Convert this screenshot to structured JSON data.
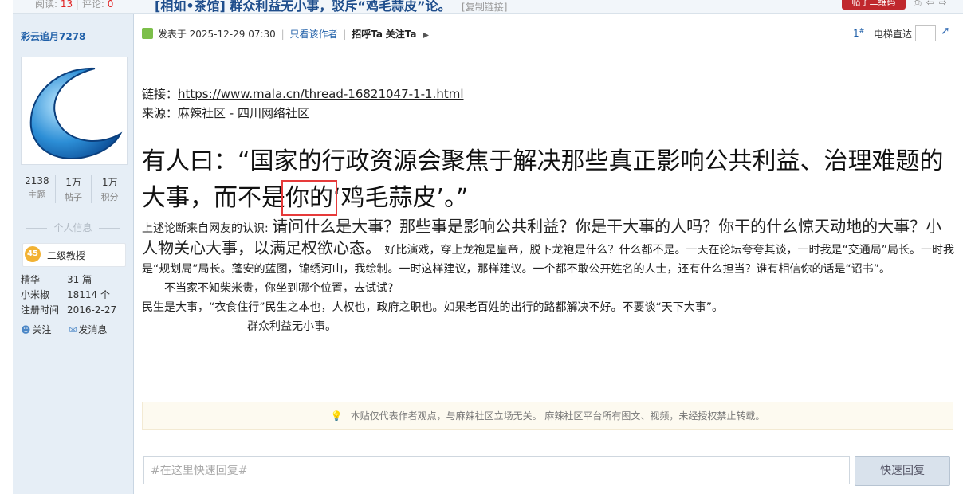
{
  "top": {
    "reads_label": "阅读:",
    "reads": "13",
    "comments_label": "评论:",
    "comments": "0",
    "title": "[相如•茶馆] 群众利益无小事，驳斥“鸡毛蒜皮”论。",
    "copy_link": "[复制链接]",
    "qr_button": "帖子二维码",
    "icons": [
      "print-icon",
      "prev-icon",
      "next-icon"
    ]
  },
  "author": {
    "name": "彩云追月7278",
    "stats": [
      {
        "value": "2138",
        "label": "主题"
      },
      {
        "value": "1万",
        "label": "帖子"
      },
      {
        "value": "1万",
        "label": "积分"
      }
    ],
    "section_title": "个人信息",
    "rank_level": "45",
    "rank_label": "二级教授",
    "info": [
      {
        "key": "精华",
        "value": "31 篇"
      },
      {
        "key": "小米椒",
        "value": "18114 个"
      },
      {
        "key": "注册时间",
        "value": "2016-2-27"
      }
    ],
    "follow_label": "关注",
    "message_label": "发消息"
  },
  "post": {
    "posted_at": "发表于 2025-12-29 07:30",
    "only_author": "只看该作者",
    "greet": "招呼Ta",
    "follow": "关注Ta",
    "floor_number": "1",
    "floor_mark": "#",
    "elevator_label": "电梯直达",
    "link_label": "链接：",
    "link_url": "https://www.mala.cn/thread-16821047-1-1.html",
    "source": "来源：麻辣社区  - 四川网络社区",
    "big_1": "有人曰：“国家的行政资源会聚焦于解决那些真正影响公共利益、治理难题的大事，而不是",
    "big_hl": "你的",
    "big_2": "‘鸡毛蒜皮’。”",
    "p1_small": "上述论断来自网友的认识: ",
    "p1_big": "请问什么是大事？那些事是影响公共利益？你是干大事的人吗？你干的什么惊天动地的大事？小人物关心大事，以满足权欲心态。",
    "p1_rest": " 好比演戏，穿上龙袍是皇帝，脱下龙袍是什么？什么都不是。一天在论坛夸夸其谈，一时我是“交通局”局长。一时我是“规划局”局长。蓬安的蓝图，锦绣河山，我绘制。一时这样建议，那样建议。一个都不敢公开姓名的人士，还有什么担当？谁有相信你的话是“诏书”。",
    "p2": "不当家不知柴米贵，你坐到哪个位置，去试试?",
    "p3": "民生是大事，“衣食住行”民生之本也，人权也，政府之职也。如果老百姓的出行的路都解决不好。不要谈“天下大事”。",
    "p4": "群众利益无小事。"
  },
  "notice": "本贴仅代表作者观点，与麻辣社区立场无关。  麻辣社区平台所有图文、视频，未经授权禁止转载。",
  "reply": {
    "placeholder": "#在这里快速回复#",
    "button": "快速回复"
  }
}
